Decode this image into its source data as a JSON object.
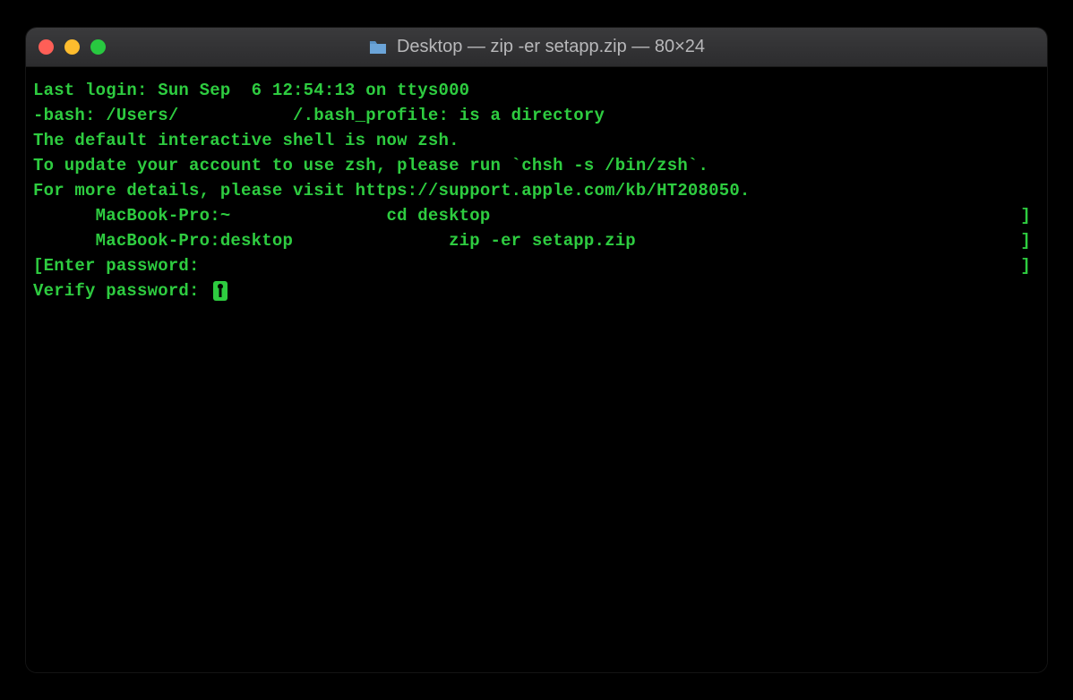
{
  "window": {
    "title": "Desktop — zip -er setapp.zip — 80×24"
  },
  "terminal": {
    "lines": {
      "last_login": "Last login: Sun Sep  6 12:54:13 on ttys000",
      "bash_error": "-bash: /Users/           /.bash_profile: is a directory",
      "blank": "",
      "zsh_notice": "The default interactive shell is now zsh.",
      "zsh_update": "To update your account to use zsh, please run `chsh -s /bin/zsh`.",
      "zsh_details": "For more details, please visit https://support.apple.com/kb/HT208050.",
      "prompt1": "      MacBook-Pro:~               cd desktop",
      "prompt2": "      MacBook-Pro:desktop               zip -er setapp.zip",
      "enter_password_left": "[",
      "enter_password": "Enter password: ",
      "verify_password": "Verify password: ",
      "right_bracket": "]"
    }
  },
  "colors": {
    "text": "#2ecc40",
    "bg": "#000000",
    "titlebar": "#2c2c2e"
  }
}
